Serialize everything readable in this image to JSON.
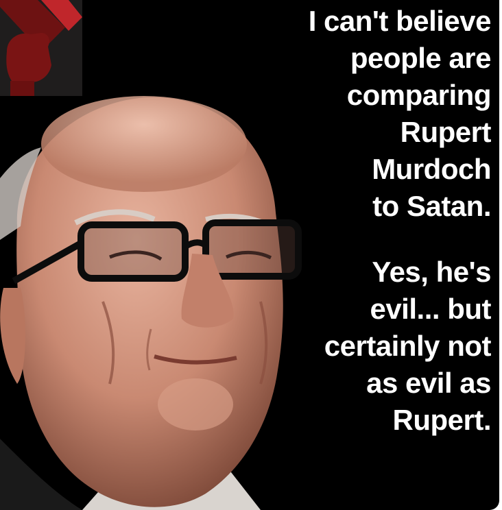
{
  "meme": {
    "lines_part1": [
      "I can't believe",
      "people are",
      "comparing",
      "Rupert",
      "Murdoch",
      "to Satan."
    ],
    "lines_part2": [
      "Yes, he's",
      "evil... but",
      "certainly not",
      "as evil as",
      "Rupert."
    ]
  },
  "logo": {
    "icon": "raised-fist-icon",
    "colors": {
      "fist": "#7a1414",
      "flag": "#c0262b",
      "bg": "#1f1d1d"
    }
  },
  "colors": {
    "background": "#000000",
    "text": "#ffffff"
  }
}
